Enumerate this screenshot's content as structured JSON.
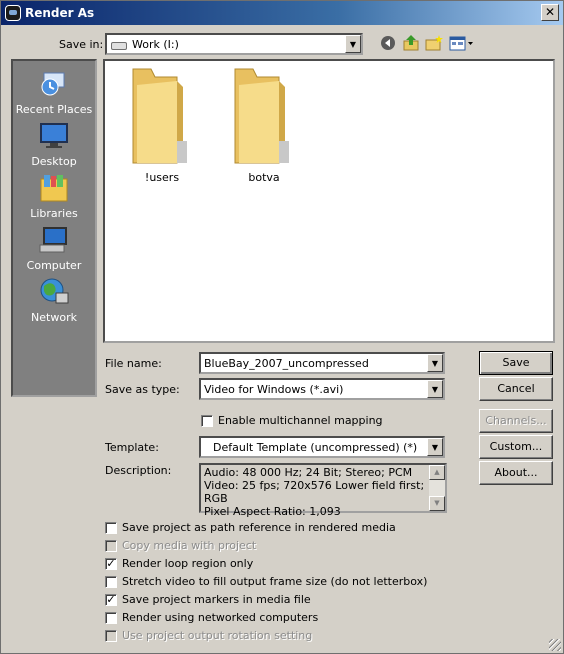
{
  "window": {
    "title": "Render As",
    "close_symbol": "✕"
  },
  "save_in": {
    "label": "Save in:",
    "value": "Work (I:)",
    "drive_icon": "drive-icon"
  },
  "toolbar": {
    "icons": [
      "back-icon",
      "up-folder-icon",
      "new-folder-icon",
      "view-menu-icon"
    ]
  },
  "places": [
    {
      "label": "Recent Places",
      "icon": "recent-places-icon"
    },
    {
      "label": "Desktop",
      "icon": "desktop-icon"
    },
    {
      "label": "Libraries",
      "icon": "libraries-icon"
    },
    {
      "label": "Computer",
      "icon": "computer-icon"
    },
    {
      "label": "Network",
      "icon": "network-icon"
    }
  ],
  "files": [
    {
      "name": "!users",
      "icon": "folder-icon"
    },
    {
      "name": "botva",
      "icon": "folder-icon"
    }
  ],
  "file_name": {
    "label": "File name:",
    "value": "BlueBay_2007_uncompressed"
  },
  "save_as_type": {
    "label": "Save as type:",
    "value": "Video for Windows (*.avi)"
  },
  "enable_multichannel": {
    "label": "Enable multichannel mapping",
    "checked": false
  },
  "template": {
    "label": "Template:",
    "value": "Default Template (uncompressed) (*)"
  },
  "description": {
    "label": "Description:",
    "lines": [
      "Audio: 48 000 Hz; 24 Bit; Stereo; PCM",
      "Video: 25 fps; 720x576 Lower field first; RGB",
      "Pixel Aspect Ratio: 1,093"
    ]
  },
  "buttons": {
    "save": "Save",
    "cancel": "Cancel",
    "channels": "Channels...",
    "custom": "Custom...",
    "about": "About..."
  },
  "options": [
    {
      "label": "Save project as path reference in rendered media",
      "checked": false,
      "disabled": false
    },
    {
      "label": "Copy media with project",
      "checked": false,
      "disabled": true
    },
    {
      "label": "Render loop region only",
      "checked": true,
      "disabled": false
    },
    {
      "label": "Stretch video to fill output frame size (do not letterbox)",
      "checked": false,
      "disabled": false
    },
    {
      "label": "Save project markers in media file",
      "checked": true,
      "disabled": false
    },
    {
      "label": "Render using networked computers",
      "checked": false,
      "disabled": false
    },
    {
      "label": "Use project output rotation setting",
      "checked": false,
      "disabled": true
    }
  ],
  "glyphs": {
    "check": "✓",
    "dropdown": "▼",
    "scroll_up": "▲",
    "scroll_down": "▼"
  }
}
